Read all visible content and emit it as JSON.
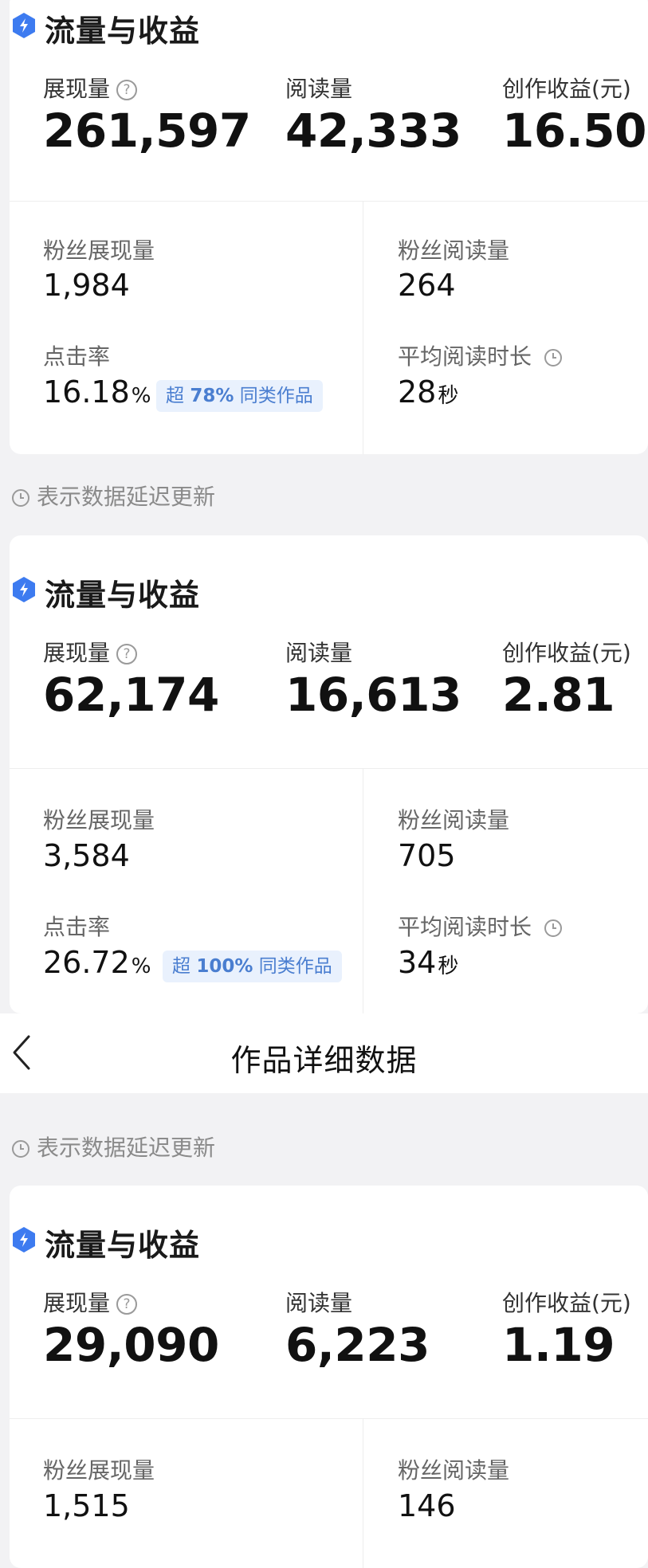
{
  "cards": [
    {
      "title": "流量与收益",
      "metrics": [
        {
          "label": "展现量",
          "value": "261,597"
        },
        {
          "label": "阅读量",
          "value": "42,333"
        },
        {
          "label": "创作收益(元)",
          "value": "16.50"
        }
      ],
      "fans_impressions_label": "粉丝展现量",
      "fans_impressions_value": "1,984",
      "fans_reads_label": "粉丝阅读量",
      "fans_reads_value": "264",
      "ctr_label": "点击率",
      "ctr_value": "16.18",
      "ctr_unit": "%",
      "badge_prefix": "超",
      "badge_value": "78%",
      "badge_suffix": "同类作品",
      "avg_read_label": "平均阅读时长",
      "avg_read_value": "28",
      "avg_read_unit": "秒"
    },
    {
      "title": "流量与收益",
      "metrics": [
        {
          "label": "展现量",
          "value": "62,174"
        },
        {
          "label": "阅读量",
          "value": "16,613"
        },
        {
          "label": "创作收益(元)",
          "value": "2.81"
        }
      ],
      "fans_impressions_label": "粉丝展现量",
      "fans_impressions_value": "3,584",
      "fans_reads_label": "粉丝阅读量",
      "fans_reads_value": "705",
      "ctr_label": "点击率",
      "ctr_value": "26.72",
      "ctr_unit": "%",
      "badge_prefix": "超",
      "badge_value": "100%",
      "badge_suffix": "同类作品",
      "avg_read_label": "平均阅读时长",
      "avg_read_value": "34",
      "avg_read_unit": "秒"
    },
    {
      "title": "流量与收益",
      "metrics": [
        {
          "label": "展现量",
          "value": "29,090"
        },
        {
          "label": "阅读量",
          "value": "6,223"
        },
        {
          "label": "创作收益(元)",
          "value": "1.19"
        }
      ],
      "fans_impressions_label": "粉丝展现量",
      "fans_impressions_value": "1,515",
      "fans_reads_label": "粉丝阅读量",
      "fans_reads_value": "146"
    }
  ],
  "delay_note": "表示数据延迟更新",
  "help_glyph": "?",
  "nav": {
    "title": "作品详细数据",
    "back_icon": "chevron-left-icon"
  },
  "colors": {
    "accent": "#4a7ed0",
    "icon_blue": "#3d7bf0",
    "badge_bg": "#e9f1fd",
    "page_bg": "#f2f2f4"
  }
}
